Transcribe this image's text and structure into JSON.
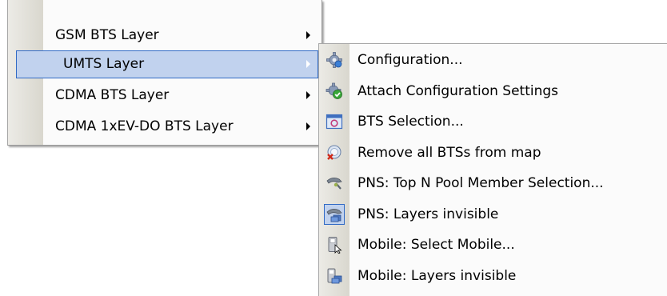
{
  "main_menu": {
    "items": [
      {
        "label": "GSM BTS Layer",
        "has_submenu": true
      },
      {
        "label": "UMTS Layer",
        "has_submenu": true,
        "highlighted": true
      },
      {
        "label": "CDMA BTS Layer",
        "has_submenu": true
      },
      {
        "label": "CDMA 1xEV-DO BTS Layer",
        "has_submenu": true
      }
    ]
  },
  "sub_menu": {
    "items": [
      {
        "label": "Configuration...",
        "icon": "gear-icon"
      },
      {
        "label": "Attach Configuration Settings",
        "icon": "gear-check-icon"
      },
      {
        "label": "BTS Selection...",
        "icon": "bts-selection-icon"
      },
      {
        "label": "Remove all BTSs from map",
        "icon": "remove-bts-icon"
      },
      {
        "label": "PNS: Top N Pool Member Selection...",
        "icon": "pns-icon"
      },
      {
        "label": "PNS: Layers invisible",
        "icon": "pns-layers-icon",
        "checked": true
      },
      {
        "label": "Mobile: Select Mobile...",
        "icon": "mobile-select-icon"
      },
      {
        "label": "Mobile: Layers invisible",
        "icon": "mobile-layers-icon"
      }
    ]
  },
  "colors": {
    "highlight_fill": "#c1d2ee",
    "highlight_border": "#316ac5",
    "menu_background": "#fbfbfb",
    "gutter": "#e4e2da"
  }
}
